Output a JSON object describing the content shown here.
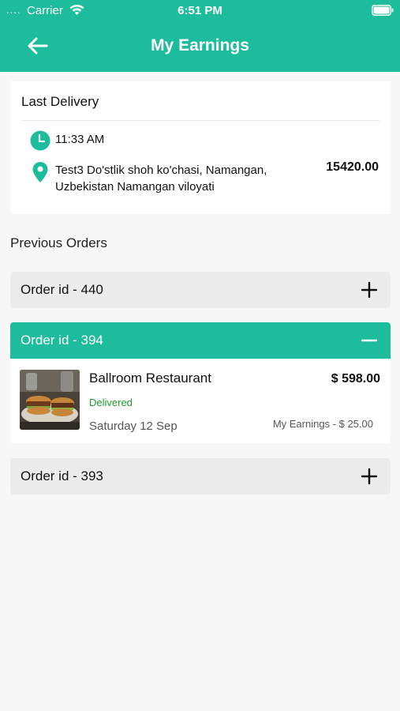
{
  "status_bar": {
    "signal": "....",
    "carrier": "Carrier",
    "time": "6:51 PM"
  },
  "header": {
    "back_icon": "arrow-left-icon",
    "title": "My Earnings",
    "color": "#1dbc9c"
  },
  "last_delivery": {
    "title": "Last Delivery",
    "time": "11:33 AM",
    "address": "Test3 Do'stlik shoh ko'chasi, Namangan, Uzbekistan  Namangan viloyati",
    "amount": "15420.00"
  },
  "previous_orders": {
    "title": "Previous Orders",
    "orders": [
      {
        "label": "Order id - 440",
        "expanded": false
      },
      {
        "label": "Order id - 394",
        "expanded": true
      },
      {
        "label": "Order id - 393",
        "expanded": false
      }
    ],
    "expanded_detail": {
      "restaurant": "Ballroom Restaurant",
      "status": "Delivered",
      "date": "Saturday 12 Sep",
      "price": "$ 598.00",
      "earnings": "My Earnings - $ 25.00",
      "status_color": "#1f9e2c"
    }
  }
}
